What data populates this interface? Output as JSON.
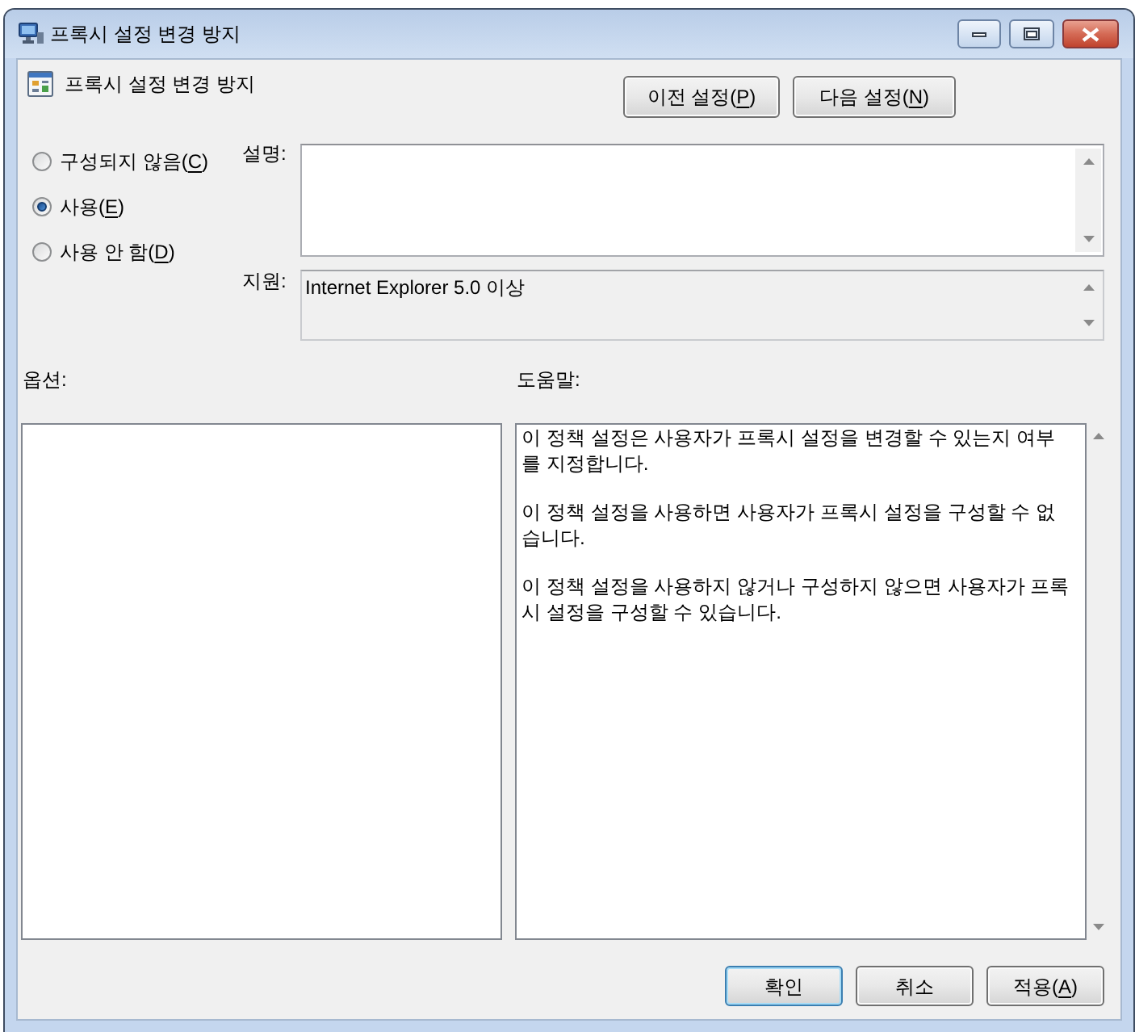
{
  "window": {
    "title": "프록시 설정 변경 방지"
  },
  "header": {
    "title": "프록시 설정 변경 방지",
    "buttons": [
      {
        "label": "이전 설정(P)",
        "access_key_underlined": true
      },
      {
        "label": "다음 설정(N)",
        "access_key_underlined": true
      }
    ]
  },
  "state_options": [
    {
      "label": "구성되지 않음(C)",
      "access_key_underlined": true,
      "selected": false
    },
    {
      "label": "사용(E)",
      "access_key_underlined": true,
      "selected": true
    },
    {
      "label": "사용 안 함(D)",
      "access_key_underlined": true,
      "selected": false
    }
  ],
  "comment": {
    "label": "설명:"
  },
  "supported_on": {
    "label": "지원:",
    "value": "Internet Explorer 5.0 이상"
  },
  "options": {
    "label": "옵션:"
  },
  "help": {
    "label": "도움말:",
    "paragraphs": [
      "이 정책 설정은 사용자가 프록시 설정을 변경할 수 있는지 여부를 지정합니다.",
      "이 정책 설정을 사용하면 사용자가 프록시 설정을 구성할 수 없습니다.",
      "이 정책 설정을 사용하지 않거나 구성하지 않으면 사용자가 프록시 설정을 구성할 수 있습니다."
    ]
  },
  "buttons": [
    {
      "label": "확인",
      "focused": true
    },
    {
      "label": "취소",
      "focused": false
    },
    {
      "label": "적용(A)",
      "access_key_underlined": true,
      "focused": false
    }
  ]
}
